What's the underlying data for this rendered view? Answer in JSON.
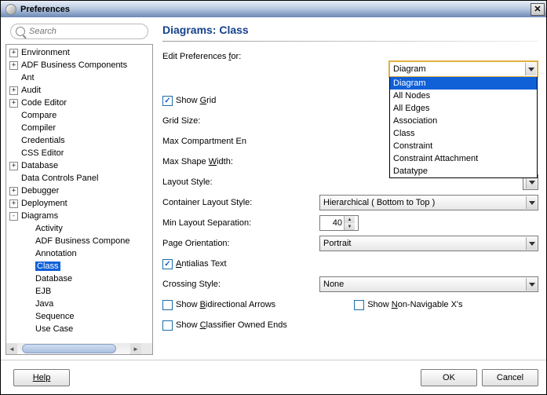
{
  "window": {
    "title": "Preferences"
  },
  "search": {
    "placeholder": "Search"
  },
  "tree": [
    {
      "label": "Environment",
      "level": 1,
      "twisty": "+"
    },
    {
      "label": "ADF Business Components",
      "level": 1,
      "twisty": "+"
    },
    {
      "label": "Ant",
      "level": 1,
      "twisty": ""
    },
    {
      "label": "Audit",
      "level": 1,
      "twisty": "+"
    },
    {
      "label": "Code Editor",
      "level": 1,
      "twisty": "+"
    },
    {
      "label": "Compare",
      "level": 1,
      "twisty": ""
    },
    {
      "label": "Compiler",
      "level": 1,
      "twisty": ""
    },
    {
      "label": "Credentials",
      "level": 1,
      "twisty": ""
    },
    {
      "label": "CSS Editor",
      "level": 1,
      "twisty": ""
    },
    {
      "label": "Database",
      "level": 1,
      "twisty": "+"
    },
    {
      "label": "Data Controls Panel",
      "level": 1,
      "twisty": ""
    },
    {
      "label": "Debugger",
      "level": 1,
      "twisty": "+"
    },
    {
      "label": "Deployment",
      "level": 1,
      "twisty": "+"
    },
    {
      "label": "Diagrams",
      "level": 1,
      "twisty": "-"
    },
    {
      "label": "Activity",
      "level": 2,
      "twisty": ""
    },
    {
      "label": "ADF Business Compone",
      "level": 2,
      "twisty": ""
    },
    {
      "label": "Annotation",
      "level": 2,
      "twisty": ""
    },
    {
      "label": "Class",
      "level": 2,
      "twisty": "",
      "selected": true
    },
    {
      "label": "Database",
      "level": 2,
      "twisty": ""
    },
    {
      "label": "EJB",
      "level": 2,
      "twisty": ""
    },
    {
      "label": "Java",
      "level": 2,
      "twisty": ""
    },
    {
      "label": "Sequence",
      "level": 2,
      "twisty": ""
    },
    {
      "label": "Use Case",
      "level": 2,
      "twisty": ""
    }
  ],
  "page": {
    "title": "Diagrams: Class",
    "editPrefsLabelPre": "Edit Preferences ",
    "editPrefsUnd": "f",
    "editPrefsLabelPost": "or:",
    "editPrefsValue": "Diagram",
    "dropdownOptions": [
      "Diagram",
      "All Nodes",
      "All Edges",
      "Association",
      "Class",
      "Constraint",
      "Constraint Attachment",
      "Datatype"
    ],
    "showGridPre": "Show ",
    "showGridUnd": "G",
    "showGridPost": "rid",
    "gridSizeLabel": "Grid Size:",
    "maxCompartLabel": "Max Compartment En",
    "maxShapePre": "Max Shape ",
    "maxShapeUnd": "W",
    "maxShapePost": "idth:",
    "layoutStyleLabel": "Layout Style:",
    "containerLayoutLabel": "Container Layout Style:",
    "containerLayoutValue": "Hierarchical ( Bottom to Top )",
    "minLayoutLabel": "Min Layout Separation:",
    "minLayoutValue": "40",
    "pageOrientLabel": "Page Orientation:",
    "pageOrientValue": "Portrait",
    "antialiasPre": "",
    "antialiasUnd": "A",
    "antialiasPost": "ntialias Text",
    "crossingLabel": "Crossing Style:",
    "crossingValue": "None",
    "showBidiPre": "Show ",
    "showBidiUnd": "B",
    "showBidiPost": "idirectional Arrows",
    "showNonNavPre": "Show ",
    "showNonNavUnd": "N",
    "showNonNavPost": "on-Navigable X's",
    "showClassPre": "Show ",
    "showClassUnd": "C",
    "showClassPost": "lassifier Owned Ends"
  },
  "buttons": {
    "help": "Help",
    "ok": "OK",
    "cancel": "Cancel"
  }
}
